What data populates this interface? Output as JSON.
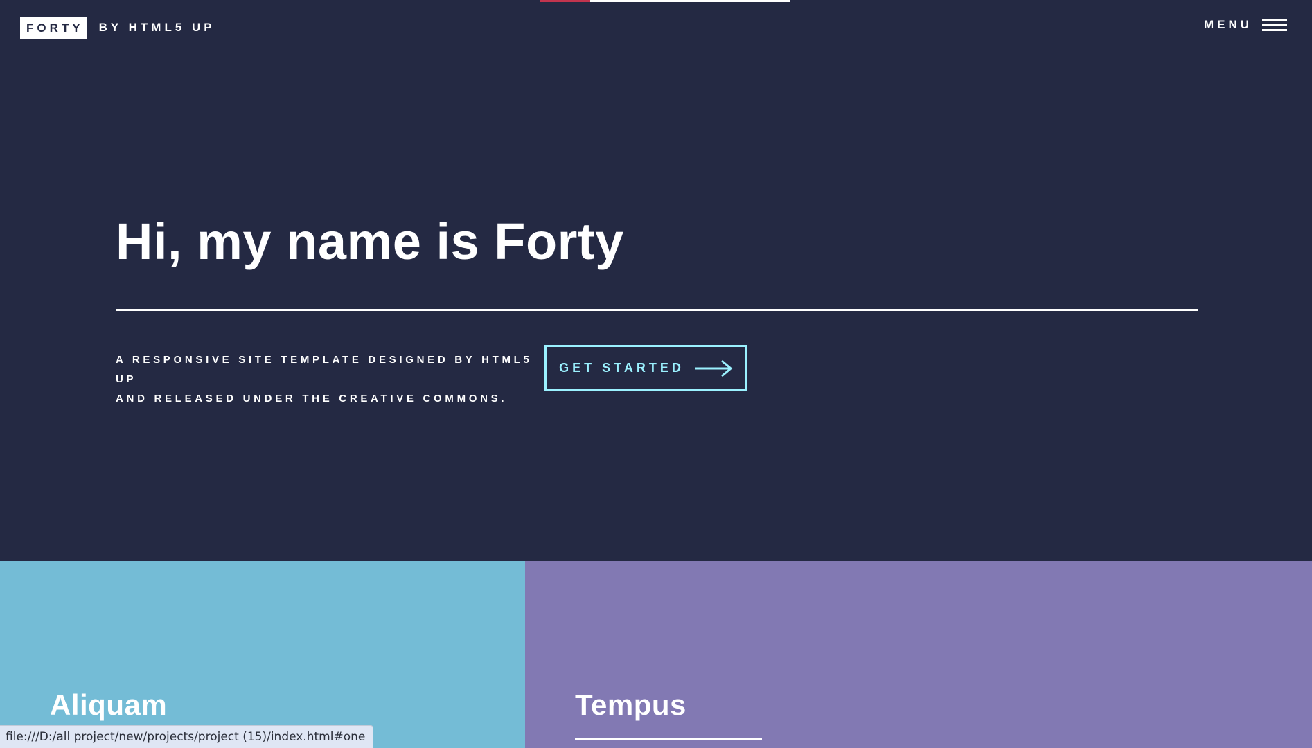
{
  "header": {
    "logo_text": "FORTY",
    "logo_subtitle": "BY HTML5 UP",
    "menu_label": "MENU",
    "menu_icon": "hamburger-icon"
  },
  "banner": {
    "title": "Hi, my name is Forty",
    "tagline_line1": "A responsive site template designed by HTML5 UP",
    "tagline_line2": "and released under the Creative Commons.",
    "cta_label": "GET STARTED",
    "cta_icon": "arrow-right-icon",
    "cta_color": "#9bf1ff"
  },
  "tiles": [
    {
      "title": "Aliquam",
      "color": "#74bcd6"
    },
    {
      "title": "Tempus",
      "color": "#8279b3"
    }
  ],
  "status_bar": {
    "url": "file:///D:/all project/new/projects/project (15)/index.html#one"
  },
  "colors": {
    "background": "#242943",
    "accent_red": "#c2344e"
  }
}
